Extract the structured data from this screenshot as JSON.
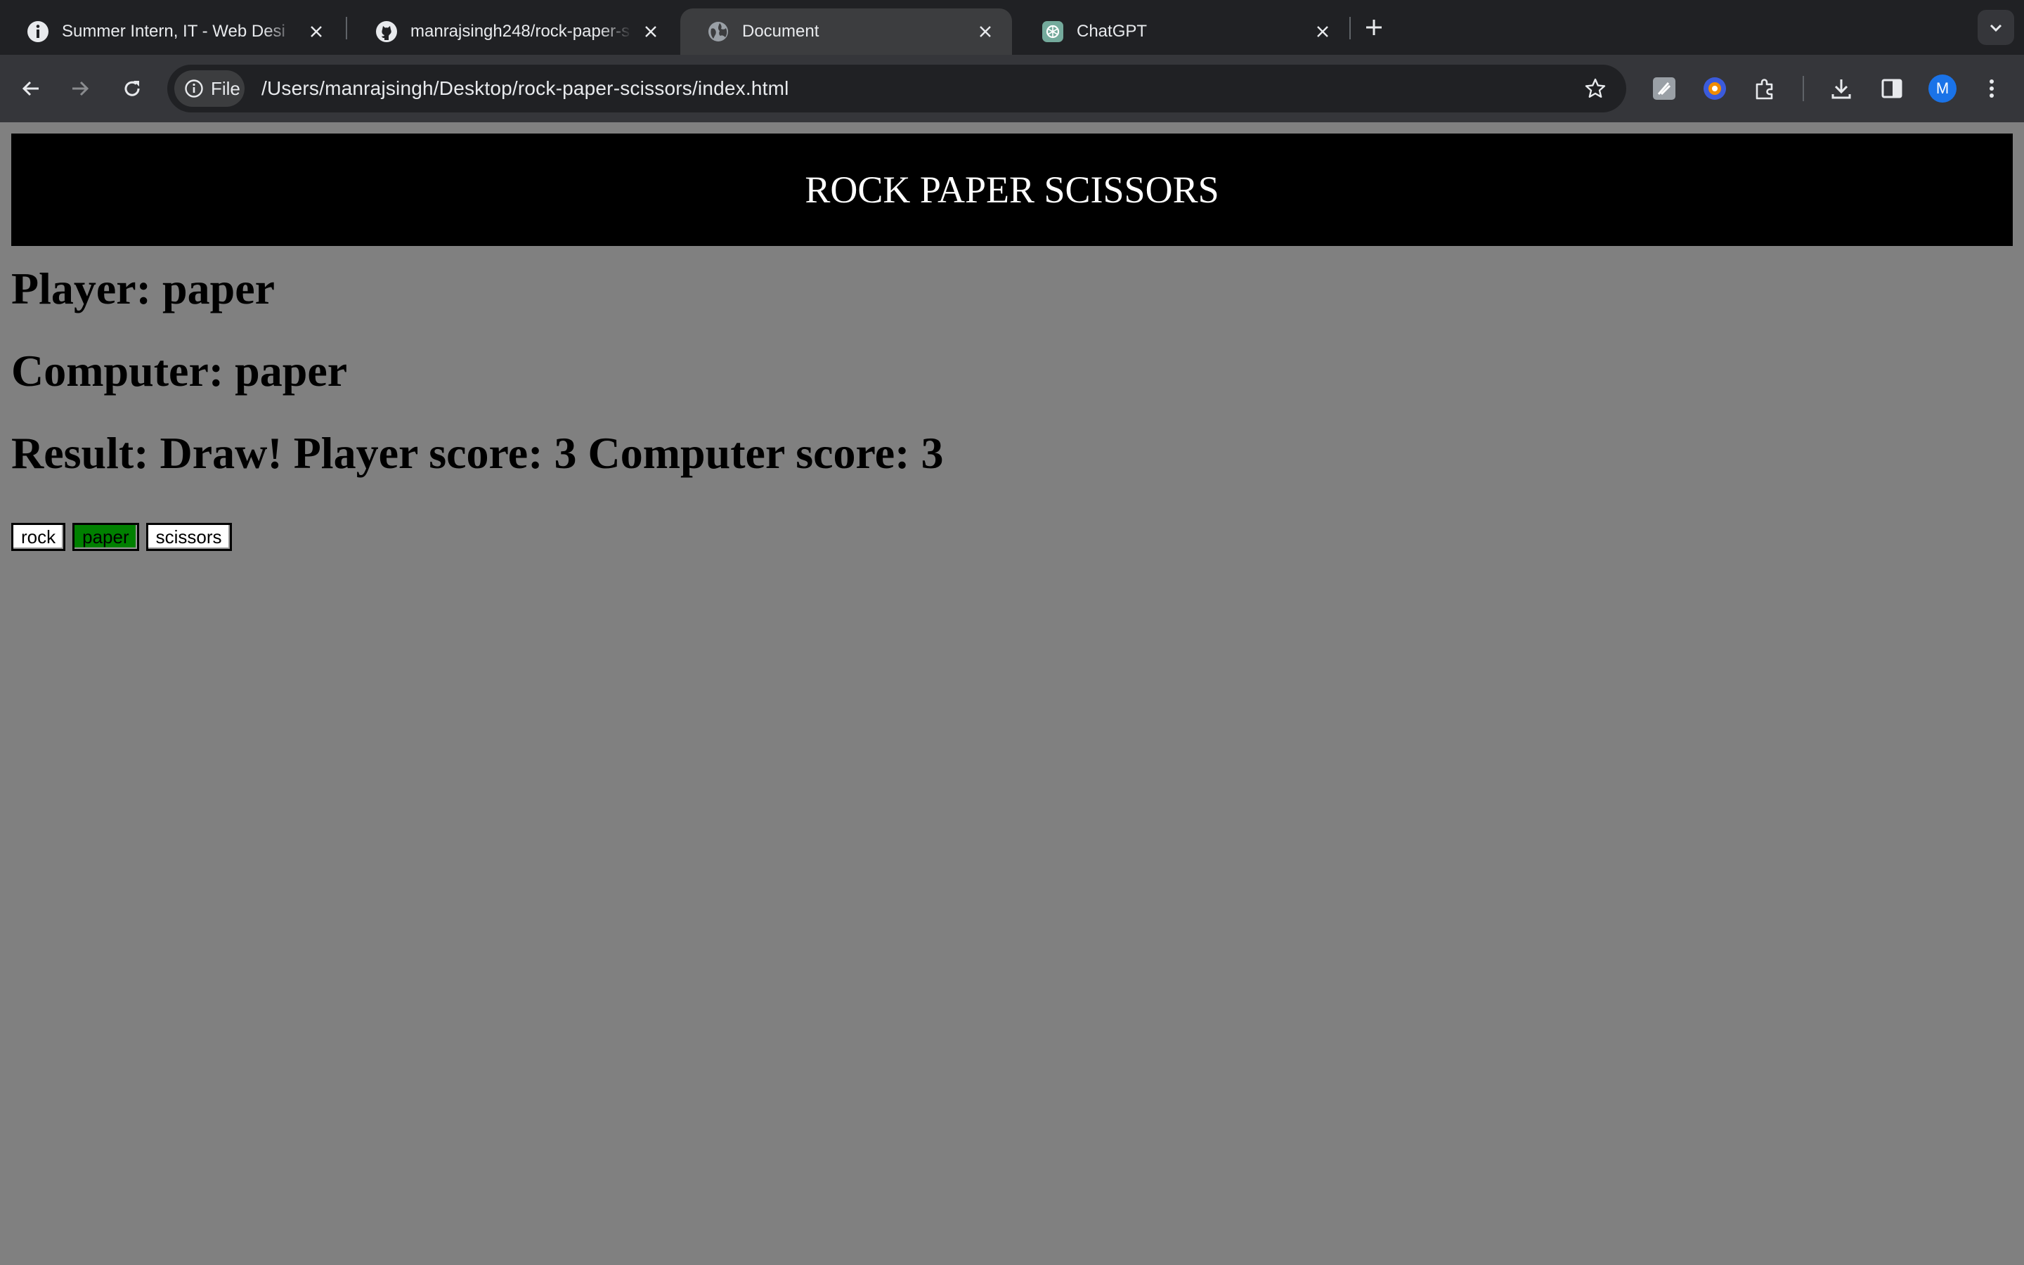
{
  "browser": {
    "tabs": [
      {
        "title": "Summer Intern, IT - Web Desi",
        "favicon": "info-icon",
        "active": false
      },
      {
        "title": "manrajsingh248/rock-paper-s",
        "favicon": "github-icon",
        "active": false
      },
      {
        "title": "Document",
        "favicon": "globe-icon",
        "active": true
      },
      {
        "title": "ChatGPT",
        "favicon": "chatgpt-icon",
        "active": false
      }
    ],
    "omnibox": {
      "chip_label": "File",
      "url": "/Users/manrajsingh/Desktop/rock-paper-scissors/index.html"
    },
    "profile_initial": "M"
  },
  "page": {
    "banner": "ROCK PAPER SCISSORS",
    "player_line": "Player: paper",
    "computer_line": "Computer: paper",
    "result_line": "Result: Draw! Player score: 3 Computer score: 3",
    "buttons": {
      "rock": "rock",
      "paper": "paper",
      "scissors": "scissors"
    },
    "selected_button": "paper"
  },
  "colors": {
    "page_background": "#808080",
    "banner_background": "#000000",
    "selected_button": "#008000",
    "tab_strip": "#202124",
    "toolbar": "#35363a"
  }
}
